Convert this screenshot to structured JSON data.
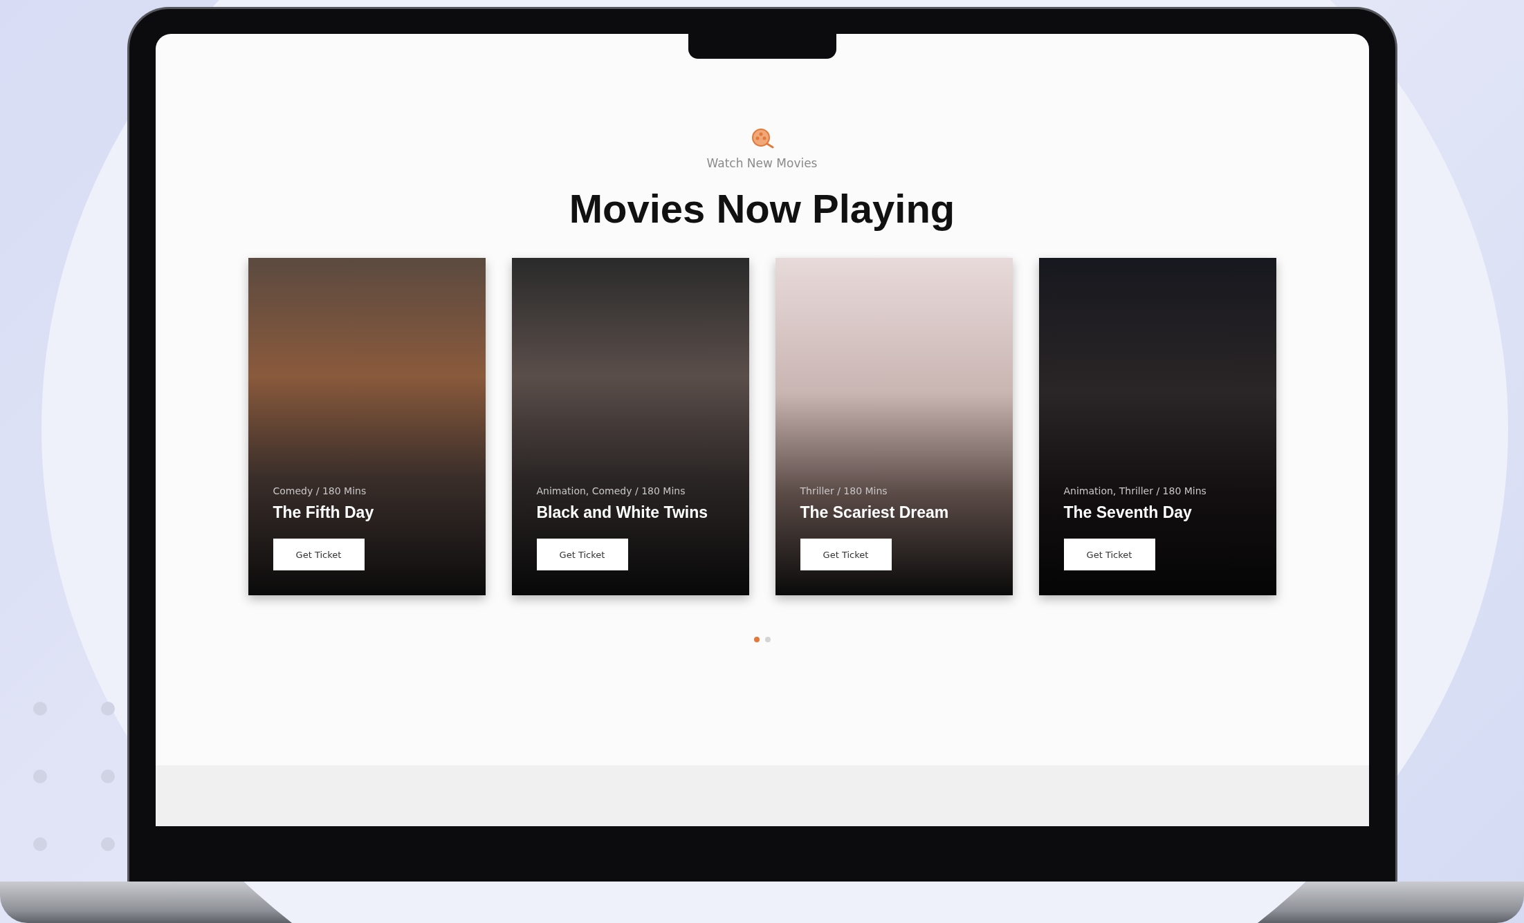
{
  "section": {
    "eyebrow": "Watch New Movies",
    "title": "Movies Now Playing"
  },
  "movies": [
    {
      "meta": "Comedy / 180 Mins",
      "title": "The Fifth Day",
      "button": "Get Ticket"
    },
    {
      "meta": "Animation, Comedy / 180 Mins",
      "title": "Black and White Twins",
      "button": "Get Ticket"
    },
    {
      "meta": "Thriller / 180 Mins",
      "title": "The Scariest Dream",
      "button": "Get Ticket"
    },
    {
      "meta": "Animation, Thriller / 180 Mins",
      "title": "The Seventh Day",
      "button": "Get Ticket"
    }
  ],
  "pagination": [
    {
      "selected": true
    },
    {
      "selected": false
    }
  ]
}
